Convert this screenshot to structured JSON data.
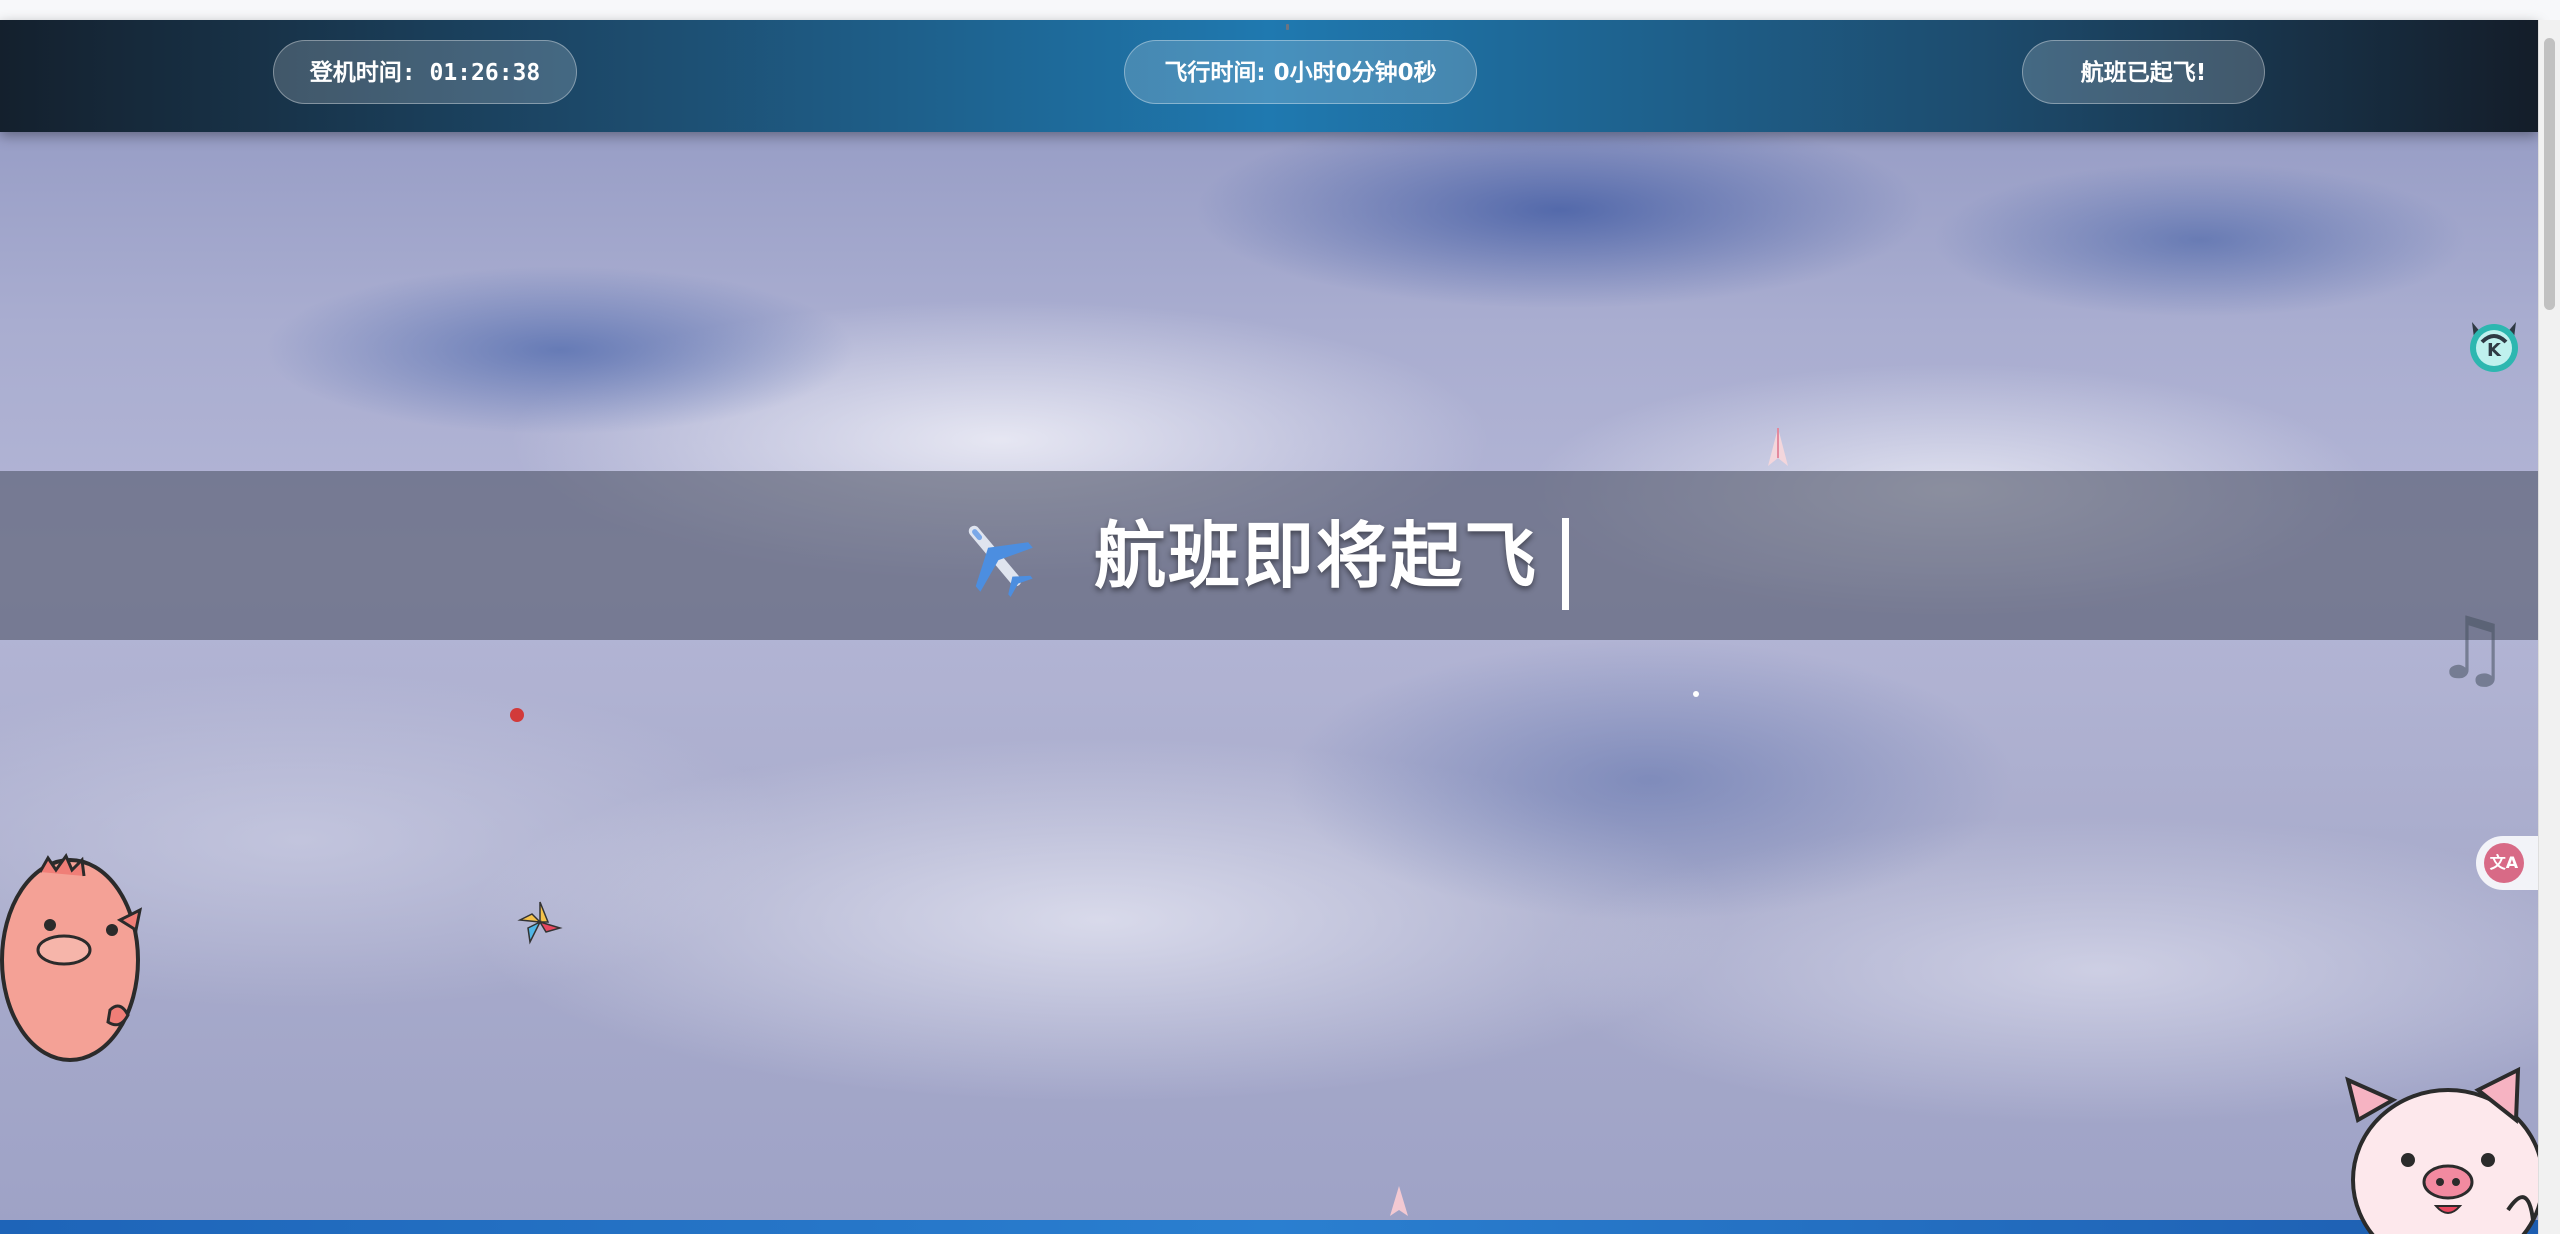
{
  "header": {
    "login_time_label": "登机时间:",
    "login_time_value": "01:26:38",
    "flight_time": "飞行时间: 0小时0分钟0秒",
    "flight_status": "航班已起飞!"
  },
  "banner": {
    "icon": "airplane-icon",
    "title": "航班即将起飞"
  },
  "widgets": {
    "music": "music-note-icon",
    "translate": "translate-icon",
    "cat": "cat-headphones-icon"
  },
  "colors": {
    "header_center": "#1f79b0",
    "header_edge": "#14202d",
    "banner_overlay": "#464a5c",
    "translate_accent": "#d86a86"
  }
}
